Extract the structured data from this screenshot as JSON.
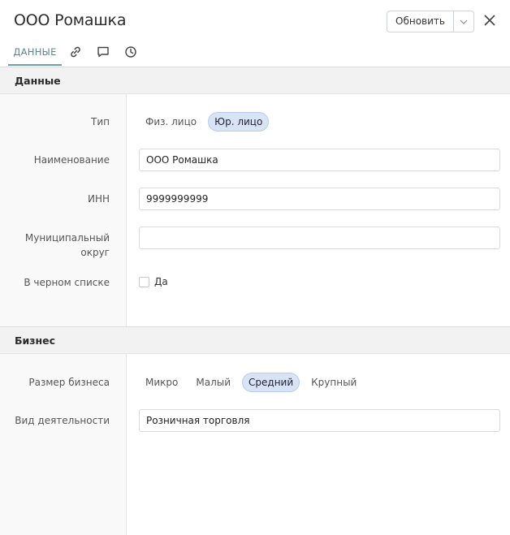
{
  "header": {
    "title": "ООО Ромашка",
    "refresh_label": "Обновить",
    "caret_icon": "chevron-down-icon",
    "close_icon": "close-icon"
  },
  "tabs": [
    {
      "label": "ДАННЫЕ",
      "active": true
    },
    {
      "icon": "link-icon"
    },
    {
      "icon": "comment-icon"
    },
    {
      "icon": "history-icon"
    }
  ],
  "sections": {
    "data": {
      "title": "Данные",
      "type": {
        "label": "Тип",
        "options": [
          "Физ. лицо",
          "Юр. лицо"
        ],
        "selected": "Юр. лицо"
      },
      "name": {
        "label": "Наименование",
        "value": "ООО Ромашка"
      },
      "inn": {
        "label": "ИНН",
        "value": "9999999999"
      },
      "municipal": {
        "label_line1": "Муниципальный",
        "label_line2": "округ",
        "value": ""
      },
      "blacklist": {
        "label": "В черном списке",
        "checkbox_label": "Да",
        "checked": false
      }
    },
    "business": {
      "title": "Бизнес",
      "size": {
        "label": "Размер бизнеса",
        "options": [
          "Микро",
          "Малый",
          "Средний",
          "Крупный"
        ],
        "selected": "Средний"
      },
      "activity": {
        "label": "Вид деятельности",
        "value": "Розничная торговля"
      }
    }
  },
  "colors": {
    "accent": "#4f8d8a",
    "selected_chip_bg": "#d8e4f5",
    "section_bg": "#f2f2f2"
  }
}
